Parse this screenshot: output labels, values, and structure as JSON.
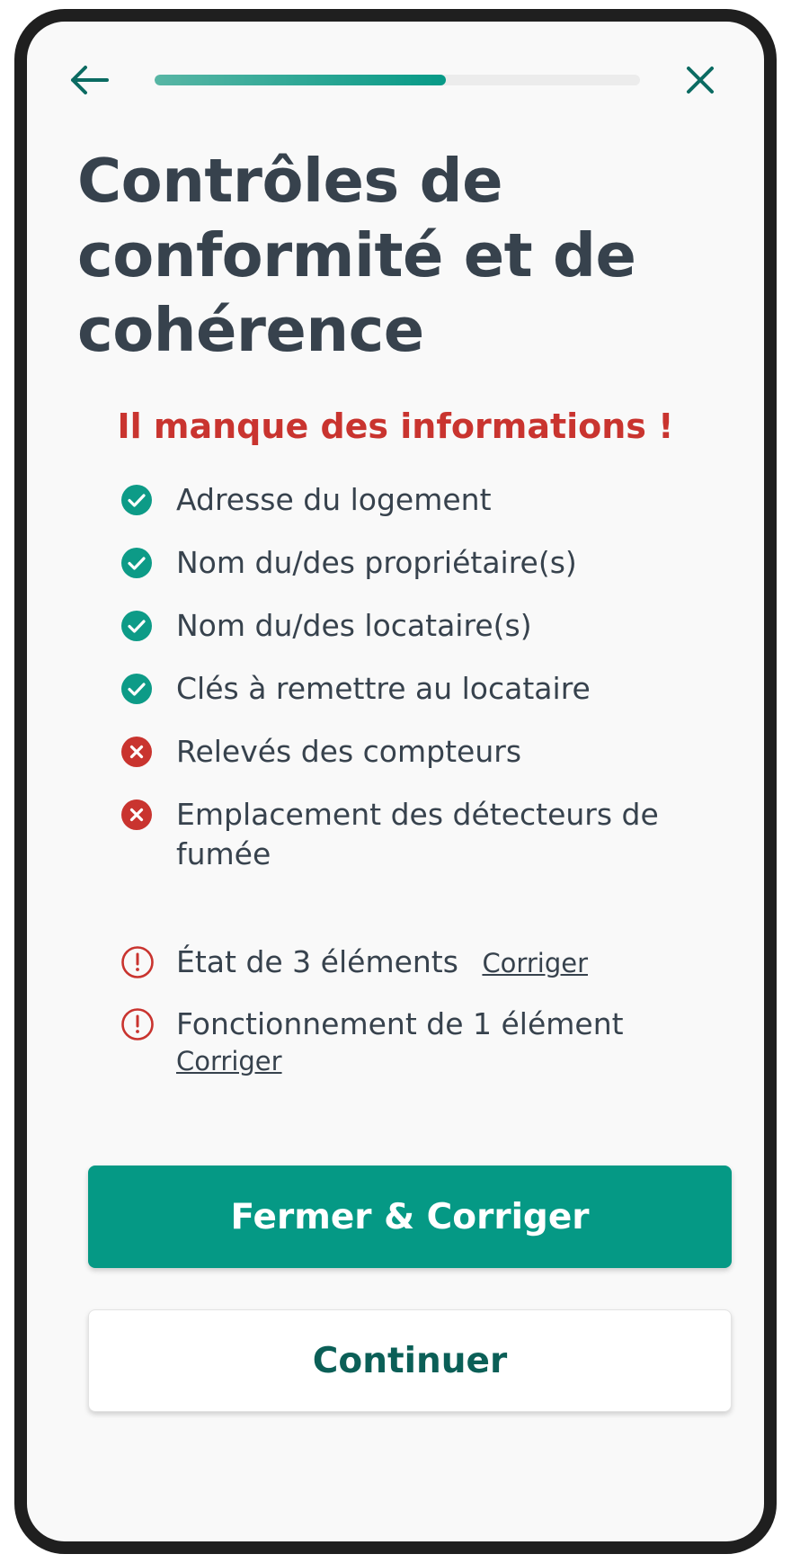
{
  "header": {
    "back_icon": "arrow-left-icon",
    "close_icon": "close-icon",
    "progress": 0.6,
    "accent_color": "#079a87"
  },
  "title": "Contrôles de conformité et de cohérence",
  "warning": {
    "text": "Il manque des informations !",
    "color": "#c9342f"
  },
  "checklist": [
    {
      "label": "Adresse du logement",
      "status": "ok",
      "icon": "check-circle-icon"
    },
    {
      "label": "Nom du/des propriétaire(s)",
      "status": "ok",
      "icon": "check-circle-icon"
    },
    {
      "label": "Nom du/des locataire(s)",
      "status": "ok",
      "icon": "check-circle-icon"
    },
    {
      "label": "Clés à remettre au locataire",
      "status": "ok",
      "icon": "check-circle-icon"
    },
    {
      "label": "Relevés des compteurs",
      "status": "missing",
      "icon": "x-circle-icon"
    },
    {
      "label": "Emplacement des détecteurs de fumée",
      "status": "missing",
      "icon": "x-circle-icon"
    }
  ],
  "issues": [
    {
      "label": "État de 3 éléments",
      "fix_label": "Corriger",
      "icon": "exclamation-circle-icon"
    },
    {
      "label": "Fonctionnement de 1 élément",
      "fix_label": "Corriger",
      "icon": "exclamation-circle-icon"
    }
  ],
  "buttons": {
    "primary_label": "Fermer & Corriger",
    "secondary_label": "Continuer"
  }
}
